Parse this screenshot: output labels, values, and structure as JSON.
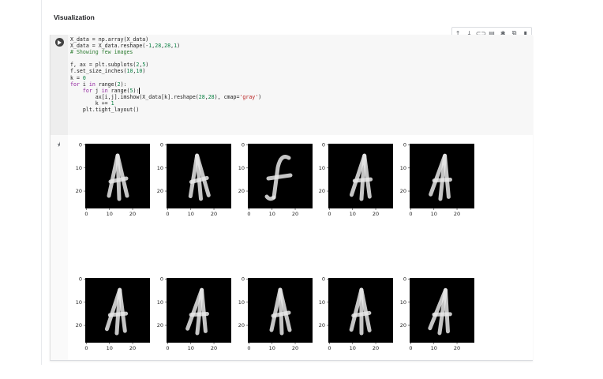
{
  "section": {
    "title": "Visualization"
  },
  "toolbar": {
    "icons": [
      "arrow-up-icon",
      "arrow-down-icon",
      "link-icon",
      "comment-icon",
      "gear-icon",
      "copy-icon",
      "trash-icon"
    ],
    "glyphs": [
      "↑",
      "↓",
      "⊂⊃",
      "▤",
      "✱",
      "⧉",
      "▮"
    ]
  },
  "code": {
    "lines": [
      "X_data = np.array(X_data)",
      "X_data = X_data.reshape(-1,28,28,1)",
      "# Showing few images",
      "",
      "f, ax = plt.subplots(2,5)",
      "f.set_size_inches(10,10)",
      "k = 0",
      "for i in range(2):",
      "    for j in range(5):",
      "        ax[i,j].imshow(X_data[k].reshape(28,28), cmap='gray')",
      "        k += 1",
      "    plt.tight_layout()"
    ]
  },
  "output": {
    "icon": "output-icon",
    "ytick_labels": [
      "0",
      "10",
      "20"
    ],
    "xtick_labels": [
      "0",
      "10",
      "20"
    ],
    "panels": [
      {
        "row": 0,
        "col": 0,
        "letter": "A"
      },
      {
        "row": 0,
        "col": 1,
        "letter": "A"
      },
      {
        "row": 0,
        "col": 2,
        "letter": "f"
      },
      {
        "row": 0,
        "col": 3,
        "letter": "A"
      },
      {
        "row": 0,
        "col": 4,
        "letter": "A"
      },
      {
        "row": 1,
        "col": 0,
        "letter": "A"
      },
      {
        "row": 1,
        "col": 1,
        "letter": "A"
      },
      {
        "row": 1,
        "col": 2,
        "letter": "A"
      },
      {
        "row": 1,
        "col": 3,
        "letter": "A"
      },
      {
        "row": 1,
        "col": 4,
        "letter": "A"
      }
    ]
  },
  "colors": {
    "image_bg": "#000000",
    "stroke": "#e8e8e8",
    "code_bg": "#f7f7f7"
  }
}
